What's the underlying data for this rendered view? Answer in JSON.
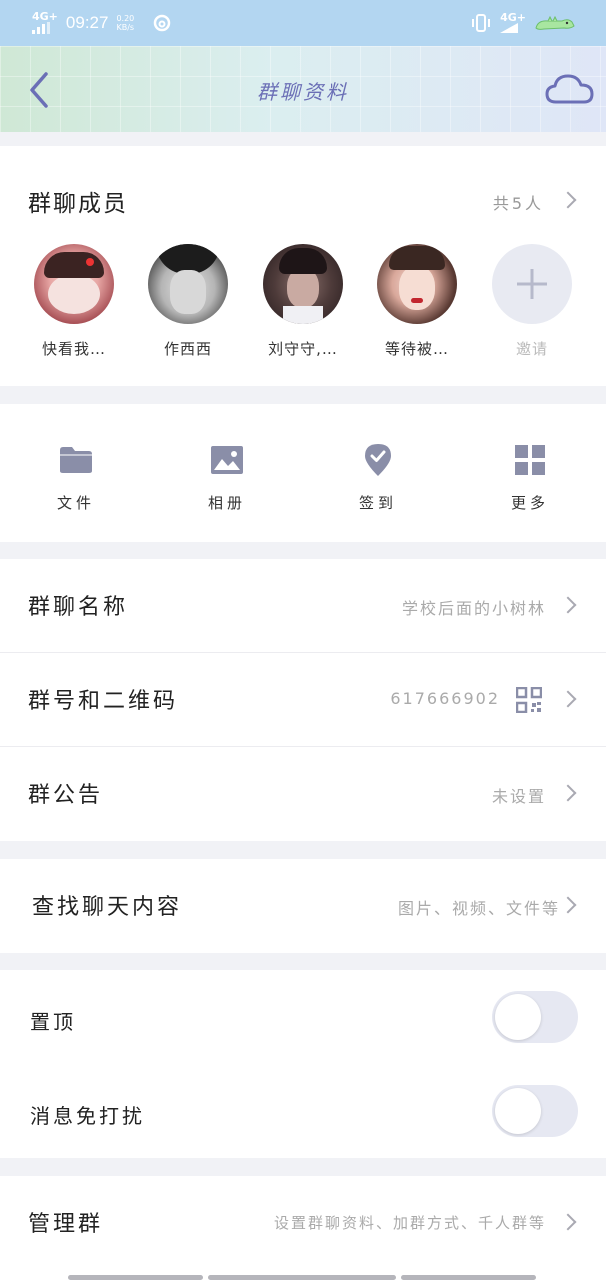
{
  "status_bar": {
    "network_left": "4G+",
    "time": "09:27",
    "speed_value": "0.20",
    "speed_unit": "KB/s",
    "network_right": "4G+",
    "icons": [
      "signal-icon",
      "netease-music-icon",
      "vibrate-icon",
      "battery-dino-icon"
    ]
  },
  "navbar": {
    "title": "群聊资料",
    "back_icon": "chevron-left-icon",
    "right_icon": "cloud-icon"
  },
  "members": {
    "title": "群聊成员",
    "count": "共5人",
    "list": [
      {
        "name": "快看我…"
      },
      {
        "name": "作西西"
      },
      {
        "name": "刘守守,…"
      },
      {
        "name": "等待被…"
      }
    ],
    "invite_label": "邀请"
  },
  "tools": [
    {
      "label": "文件",
      "icon": "folder-icon"
    },
    {
      "label": "相册",
      "icon": "image-icon"
    },
    {
      "label": "签到",
      "icon": "checkin-icon"
    },
    {
      "label": "更多",
      "icon": "grid-icon"
    }
  ],
  "info_rows": {
    "name_label": "群聊名称",
    "name_value": "学校后面的小树林",
    "number_label": "群号和二维码",
    "number_value": "617666902",
    "notice_label": "群公告",
    "notice_value": "未设置",
    "search_label": "查找聊天内容",
    "search_value": "图片、视频、文件等"
  },
  "toggles": {
    "pin_label": "置顶",
    "pin_on": false,
    "mute_label": "消息免打扰",
    "mute_on": false
  },
  "manage": {
    "label": "管理群",
    "value": "设置群聊资料、加群方式、千人群等"
  },
  "colors": {
    "status_bar": "#b3d6f1",
    "accent": "#6b6fb6",
    "toggle_off": "#e6e8f2",
    "icon_gray": "#8a8ea8"
  }
}
